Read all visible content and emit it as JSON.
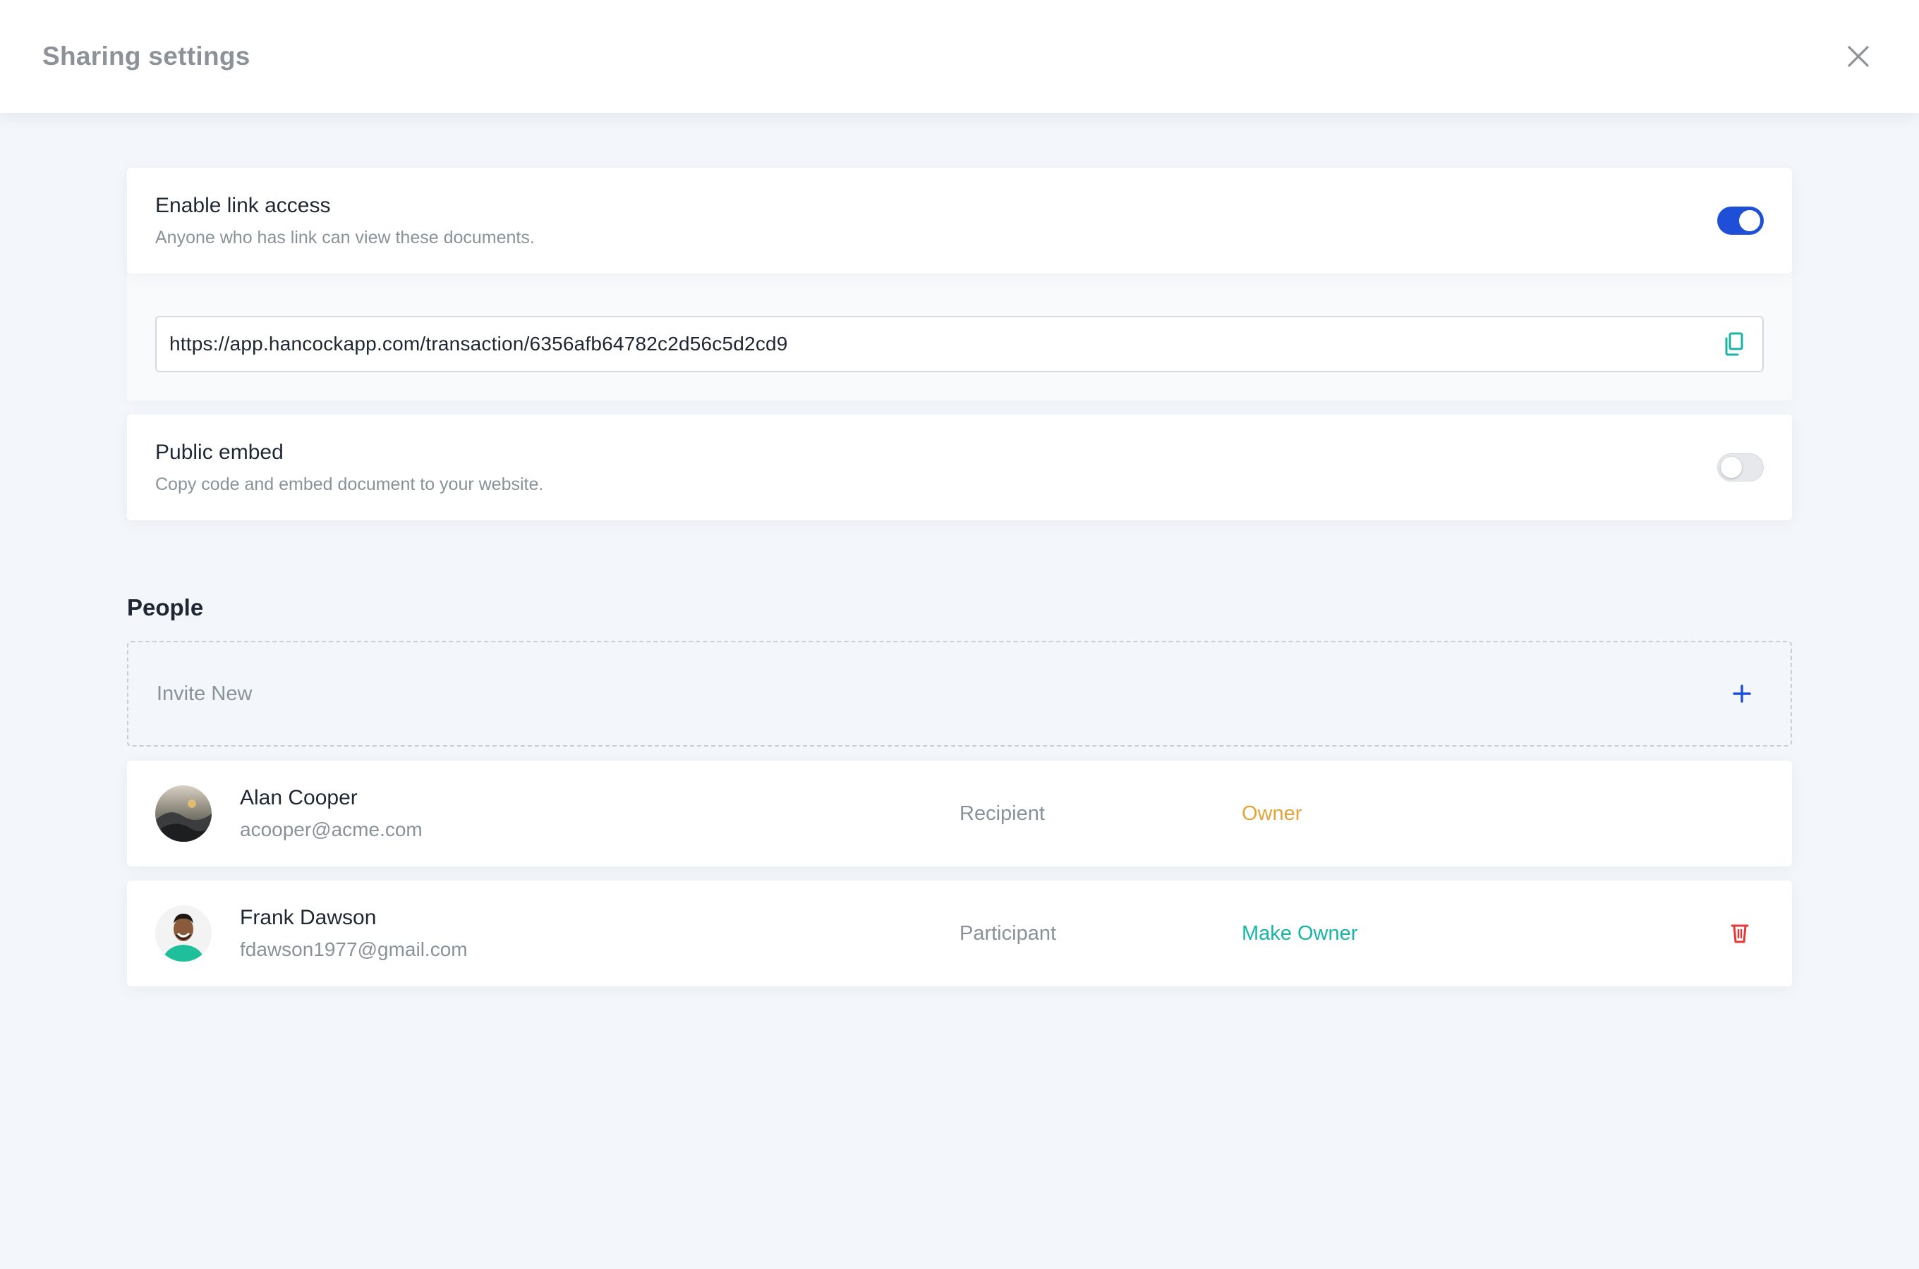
{
  "header": {
    "title": "Sharing settings",
    "close_icon": "close-icon"
  },
  "link_access": {
    "title": "Enable link access",
    "description": "Anyone who has link can view these documents.",
    "enabled": true,
    "url": "https://app.hancockapp.com/transaction/6356afb64782c2d56c5d2cd9",
    "copy_icon": "copy-icon"
  },
  "public_embed": {
    "title": "Public embed",
    "description": "Copy code and embed document to your website.",
    "enabled": false
  },
  "people": {
    "title": "People",
    "invite_label": "Invite New",
    "invite_icon": "plus-icon",
    "members": [
      {
        "name": "Alan Cooper",
        "email": "acooper@acme.com",
        "role": "Recipient",
        "action": "Owner"
      },
      {
        "name": "Frank Dawson",
        "email": "fdawson1977@gmail.com",
        "role": "Participant",
        "action": "Make Owner",
        "delete_icon": "trash-icon"
      }
    ]
  },
  "colors": {
    "accent": "#1f4fd6",
    "owner": "#e4a43b",
    "make_owner": "#18b5a7",
    "delete": "#e53935",
    "background": "#f3f6fa"
  }
}
